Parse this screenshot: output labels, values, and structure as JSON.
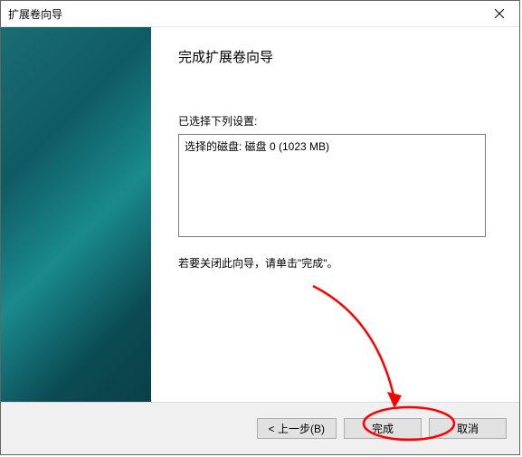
{
  "window": {
    "title": "扩展卷向导"
  },
  "content": {
    "heading": "完成扩展卷向导",
    "settings_label": "已选择下列设置:",
    "settings_value": "选择的磁盘: 磁盘 0 (1023 MB)",
    "instruction": "若要关闭此向导，请单击\"完成\"。"
  },
  "footer": {
    "back_label": "< 上一步(B)",
    "finish_label": "完成",
    "cancel_label": "取消"
  }
}
